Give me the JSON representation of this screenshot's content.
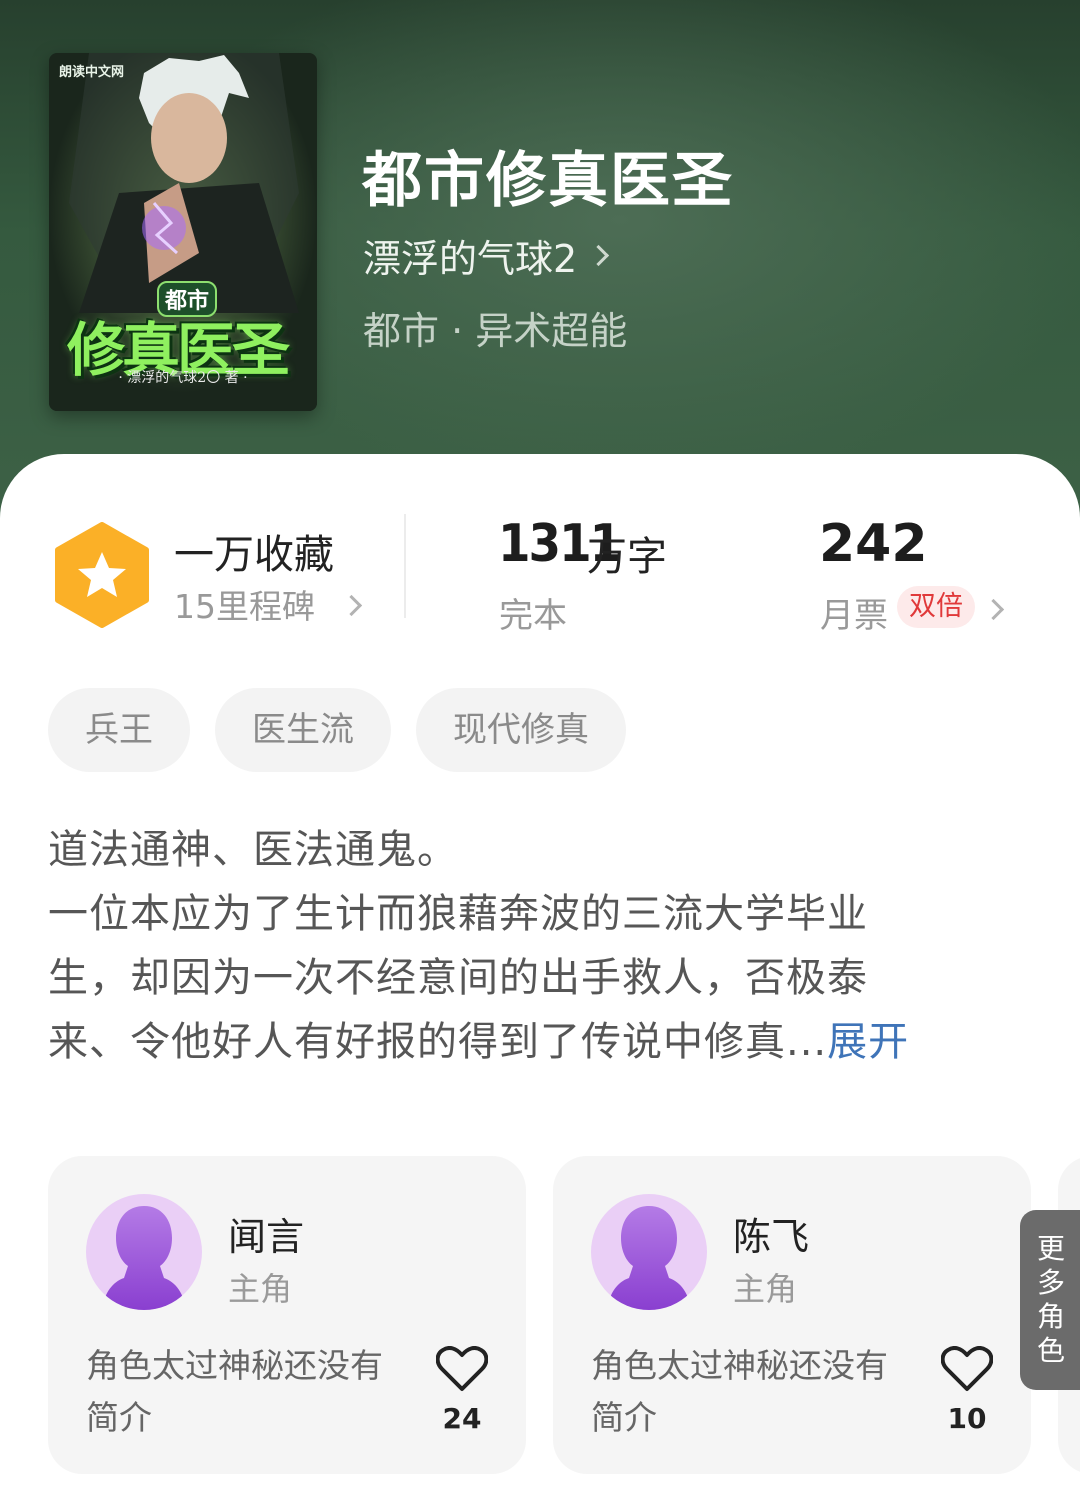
{
  "book": {
    "title": "都市修真医圣",
    "author": "漂浮的气球2",
    "genre": "都市 · 异术超能"
  },
  "cover": {
    "brand": "朗读中文网",
    "title_small": "都市",
    "title_large": "修真医圣",
    "author_line": "· 漂浮的气球2〇 著 ·"
  },
  "stats": {
    "favorites_label": "一万收藏",
    "milestone_label": "15里程碑",
    "word_count": "1311",
    "word_unit": "万字",
    "status": "完本",
    "monthly_votes": "242",
    "monthly_votes_label": "月票",
    "double_badge": "双倍"
  },
  "tags": [
    "兵王",
    "医生流",
    "现代修真"
  ],
  "description": {
    "line1": "道法通神、医法通鬼。",
    "line2": "一位本应为了生计而狼藉奔波的三流大学毕业",
    "line3": "生，却因为一次不经意间的出手救人，否极泰",
    "line4": "来、令他好人有好报的得到了传说中修真...",
    "expand": "展开"
  },
  "characters": [
    {
      "name": "闻言",
      "role": "主角",
      "desc": "角色太过神秘还没有简介",
      "likes": "24"
    },
    {
      "name": "陈飞",
      "role": "主角",
      "desc": "角色太过神秘还没有简介",
      "likes": "10"
    }
  ],
  "more_roles": "更多角色",
  "colors": {
    "header_bg": "#355a3f",
    "badge_orange": "#fbb027",
    "link_blue": "#3f74b8",
    "double_red": "#e0393a",
    "avatar_purple": "#eacff6"
  },
  "icons": {
    "star_badge": "star-hexagon-icon",
    "chevron": "chevron-right-icon",
    "like": "heart-icon",
    "avatar": "user-silhouette-icon"
  }
}
